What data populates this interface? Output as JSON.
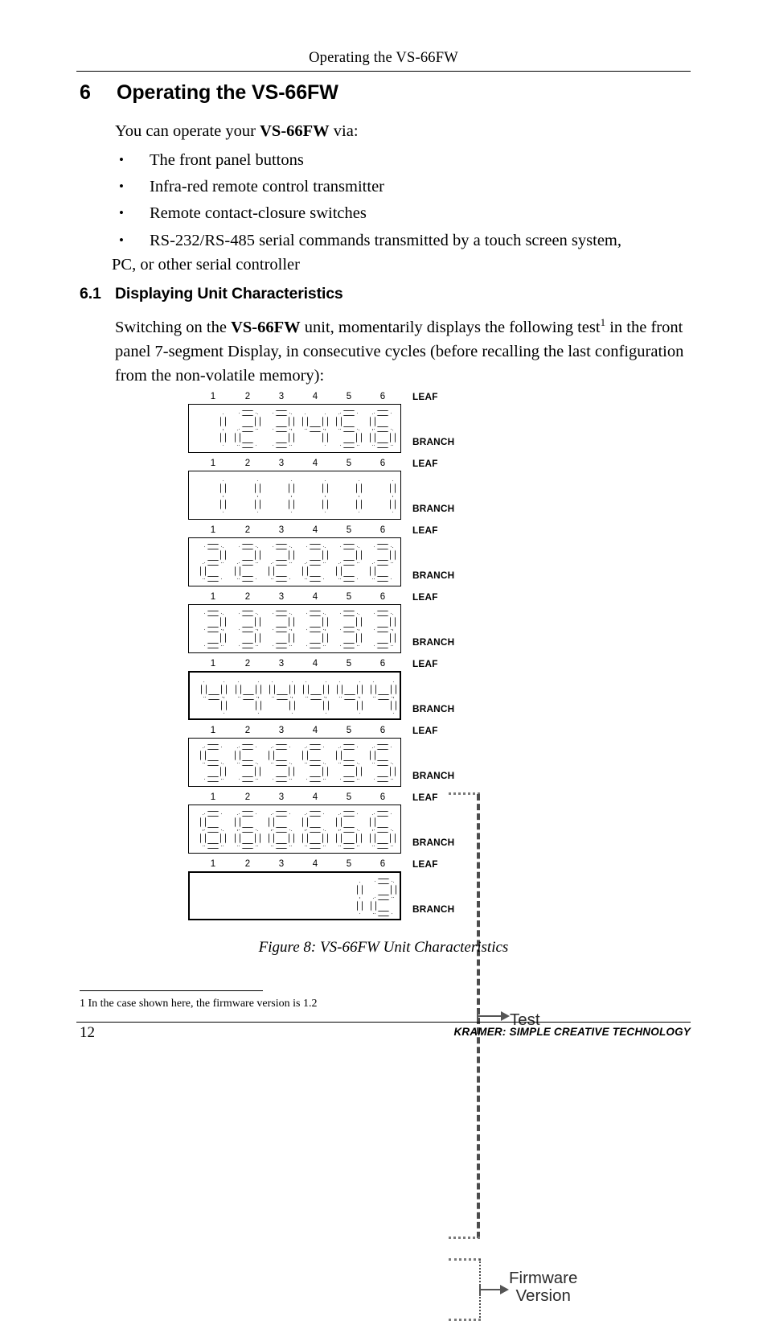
{
  "header": {
    "running_title": "Operating the VS-66FW"
  },
  "section": {
    "number": "6",
    "title": "Operating the VS-66FW"
  },
  "intro": {
    "text_before": "You can operate your ",
    "product": "VS-66FW",
    "text_after": " via:"
  },
  "bullets": [
    {
      "marker": "•",
      "text": "The front panel buttons"
    },
    {
      "marker": "•",
      "text": "Infra-red remote control transmitter"
    },
    {
      "marker": "•",
      "text": "Remote contact-closure switches"
    },
    {
      "marker": "•",
      "text": "RS-232/RS-485 serial commands transmitted by a touch screen system,",
      "continuation": "PC, or other serial controller"
    }
  ],
  "subsection": {
    "number": "6.1",
    "title": "Displaying Unit Characteristics"
  },
  "switching_paragraph": {
    "part1": "Switching on the ",
    "product": "VS-66FW",
    "part2": " unit, momentarily displays the following test",
    "footnote_marker": "1",
    "part3": " in the front panel 7-segment Display, in consecutive cycles (before recalling the last configuration from the non-volatile memory):"
  },
  "figure": {
    "column_numbers": [
      "1",
      "2",
      "3",
      "4",
      "5",
      "6"
    ],
    "leaf_label": "LEAF",
    "branch_label": "BRANCH",
    "rows": [
      {
        "digits": [
          "1",
          "2",
          "3",
          "4",
          "5",
          "6"
        ],
        "emphasis": false
      },
      {
        "digits": [
          "1",
          "1",
          "1",
          "1",
          "1",
          "1"
        ],
        "emphasis": false
      },
      {
        "digits": [
          "2",
          "2",
          "2",
          "2",
          "2",
          "2"
        ],
        "emphasis": false
      },
      {
        "digits": [
          "3",
          "3",
          "3",
          "3",
          "3",
          "3"
        ],
        "emphasis": false
      },
      {
        "digits": [
          "4",
          "4",
          "4",
          "4",
          "4",
          "4"
        ],
        "emphasis": true
      },
      {
        "digits": [
          "5",
          "5",
          "5",
          "5",
          "5",
          "5"
        ],
        "emphasis": false
      },
      {
        "digits": [
          "6",
          "6",
          "6",
          "6",
          "6",
          "6"
        ],
        "emphasis": false
      },
      {
        "digits": [
          "",
          "",
          "",
          "",
          "1",
          "2"
        ],
        "emphasis": true
      }
    ],
    "callouts": {
      "test": "Test",
      "firmware_line1": "Firmware",
      "firmware_line2": "Version"
    },
    "caption": "Figure 8: VS-66FW Unit Characteristics"
  },
  "footnote": {
    "text": "1 In the case shown here, the firmware version is 1.2"
  },
  "footer": {
    "page_number": "12",
    "brand": "KRAMER:  SIMPLE CREATIVE TECHNOLOGY"
  },
  "colors": {
    "ink": "#000000",
    "arrow": "#555555",
    "bracket": "#4c4c4c"
  }
}
